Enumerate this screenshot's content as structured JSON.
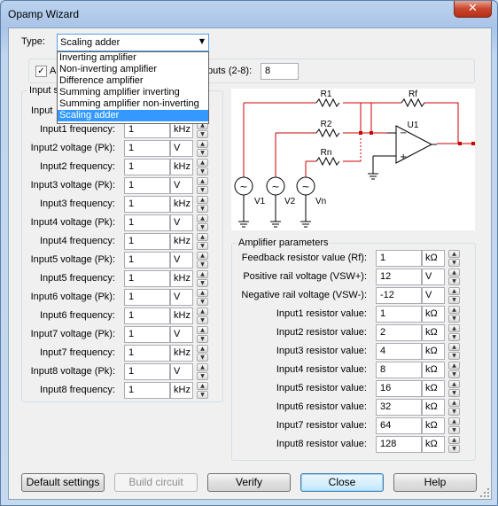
{
  "window": {
    "title": "Opamp Wizard",
    "close_glyph": "✕"
  },
  "type_row": {
    "label": "Type:",
    "selected": "Scaling adder",
    "arrow_glyph": "▼",
    "options": [
      "Inverting amplifier",
      "Non-inverting amplifier",
      "Difference amplifier",
      "Summing amplifier inverting",
      "Summing amplifier non-inverting",
      "Scaling adder"
    ]
  },
  "inputs_row": {
    "checkbox_label_visible": "A",
    "checkbox_checked": true,
    "check_glyph": "✓",
    "count_label_visible": "puts (2-8):",
    "count_value": "8"
  },
  "input_group": {
    "title_visible": "Input s",
    "first_row_label_visible": "Input",
    "rows": [
      {
        "label": "Input1 frequency:",
        "value": "1",
        "unit": "kHz"
      },
      {
        "label": "Input2 voltage (Pk):",
        "value": "1",
        "unit": "V"
      },
      {
        "label": "Input2 frequency:",
        "value": "1",
        "unit": "kHz"
      },
      {
        "label": "Input3 voltage (Pk):",
        "value": "1",
        "unit": "V"
      },
      {
        "label": "Input3 frequency:",
        "value": "1",
        "unit": "kHz"
      },
      {
        "label": "Input4 voltage (Pk):",
        "value": "1",
        "unit": "V"
      },
      {
        "label": "Input4 frequency:",
        "value": "1",
        "unit": "kHz"
      },
      {
        "label": "Input5 voltage (Pk):",
        "value": "1",
        "unit": "V"
      },
      {
        "label": "Input5 frequency:",
        "value": "1",
        "unit": "kHz"
      },
      {
        "label": "Input6 voltage (Pk):",
        "value": "1",
        "unit": "V"
      },
      {
        "label": "Input6 frequency:",
        "value": "1",
        "unit": "kHz"
      },
      {
        "label": "Input7 voltage (Pk):",
        "value": "1",
        "unit": "V"
      },
      {
        "label": "Input7 frequency:",
        "value": "1",
        "unit": "kHz"
      },
      {
        "label": "Input8 voltage (Pk):",
        "value": "1",
        "unit": "V"
      },
      {
        "label": "Input8 frequency:",
        "value": "1",
        "unit": "kHz"
      }
    ]
  },
  "schematic": {
    "labels": {
      "r1": "R1",
      "r2": "R2",
      "rn": "Rn",
      "rf": "Rf",
      "u1": "U1",
      "v1": "V1",
      "v2": "V2",
      "vn": "Vn",
      "minus": "−",
      "plus": "+",
      "sine": "~"
    },
    "colors": {
      "wire": "#cc0000",
      "component": "#000000"
    }
  },
  "amp_group": {
    "title": "Amplifier parameters",
    "rows": [
      {
        "label": "Feedback resistor value (Rf):",
        "value": "1",
        "unit": "kΩ"
      },
      {
        "label": "Positive rail voltage (VSW+):",
        "value": "12",
        "unit": "V"
      },
      {
        "label": "Negative rail voltage (VSW-):",
        "value": "-12",
        "unit": "V"
      },
      {
        "label": "Input1 resistor value:",
        "value": "1",
        "unit": "kΩ"
      },
      {
        "label": "Input2 resistor value:",
        "value": "2",
        "unit": "kΩ"
      },
      {
        "label": "Input3 resistor value:",
        "value": "4",
        "unit": "kΩ"
      },
      {
        "label": "Input4 resistor value:",
        "value": "8",
        "unit": "kΩ"
      },
      {
        "label": "Input5 resistor value:",
        "value": "16",
        "unit": "kΩ"
      },
      {
        "label": "Input6 resistor value:",
        "value": "32",
        "unit": "kΩ"
      },
      {
        "label": "Input7 resistor value:",
        "value": "64",
        "unit": "kΩ"
      },
      {
        "label": "Input8 resistor value:",
        "value": "128",
        "unit": "kΩ"
      }
    ]
  },
  "spin": {
    "up_glyph": "▲",
    "down_glyph": "▼"
  },
  "buttons": {
    "default_settings": "Default settings",
    "build_circuit": "Build circuit",
    "verify": "Verify",
    "close": "Close",
    "help": "Help"
  },
  "colors": {
    "selection": "#3399ff",
    "close_button": "#c9452e",
    "focus_border": "#569de5"
  }
}
